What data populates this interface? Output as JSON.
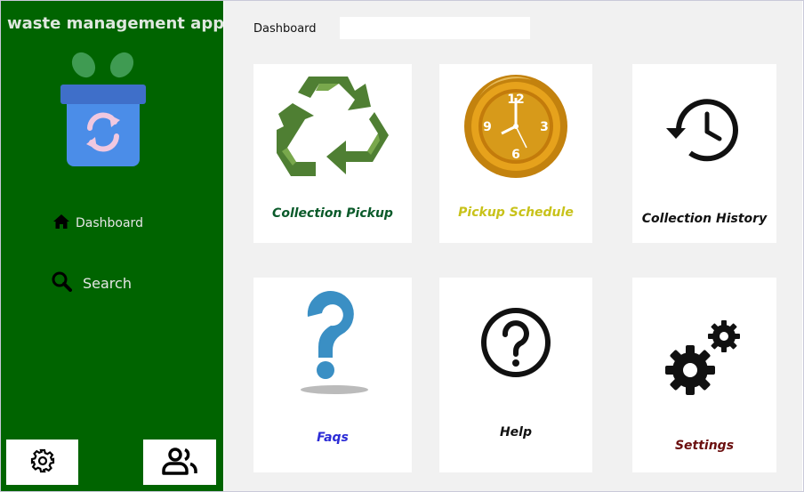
{
  "app": {
    "title": "waste management app"
  },
  "sidebar": {
    "nav": [
      {
        "label": "Dashboard",
        "icon": "home-icon"
      },
      {
        "label": "Search",
        "icon": "search-icon"
      }
    ],
    "bottom_buttons": [
      {
        "icon": "gear-icon"
      },
      {
        "icon": "users-icon"
      }
    ],
    "logo_icon": "recycle-bin-logo",
    "background": "#006400"
  },
  "header": {
    "breadcrumb": "Dashboard",
    "search": {
      "value": "",
      "placeholder": ""
    }
  },
  "cards": [
    {
      "label": "Collection Pickup",
      "icon": "recycle-icon",
      "color": "#0a5a2a"
    },
    {
      "label": "Pickup Schedule",
      "icon": "alarm-clock-icon",
      "color": "#c8c21a"
    },
    {
      "label": "Collection History",
      "icon": "history-icon",
      "color": "#111111"
    },
    {
      "label": "Faqs",
      "icon": "question-mark-icon",
      "color": "#2b2bd6"
    },
    {
      "label": "Help",
      "icon": "help-circle-icon",
      "color": "#111111"
    },
    {
      "label": "Settings",
      "icon": "gears-icon",
      "color": "#6b0f0f"
    }
  ]
}
